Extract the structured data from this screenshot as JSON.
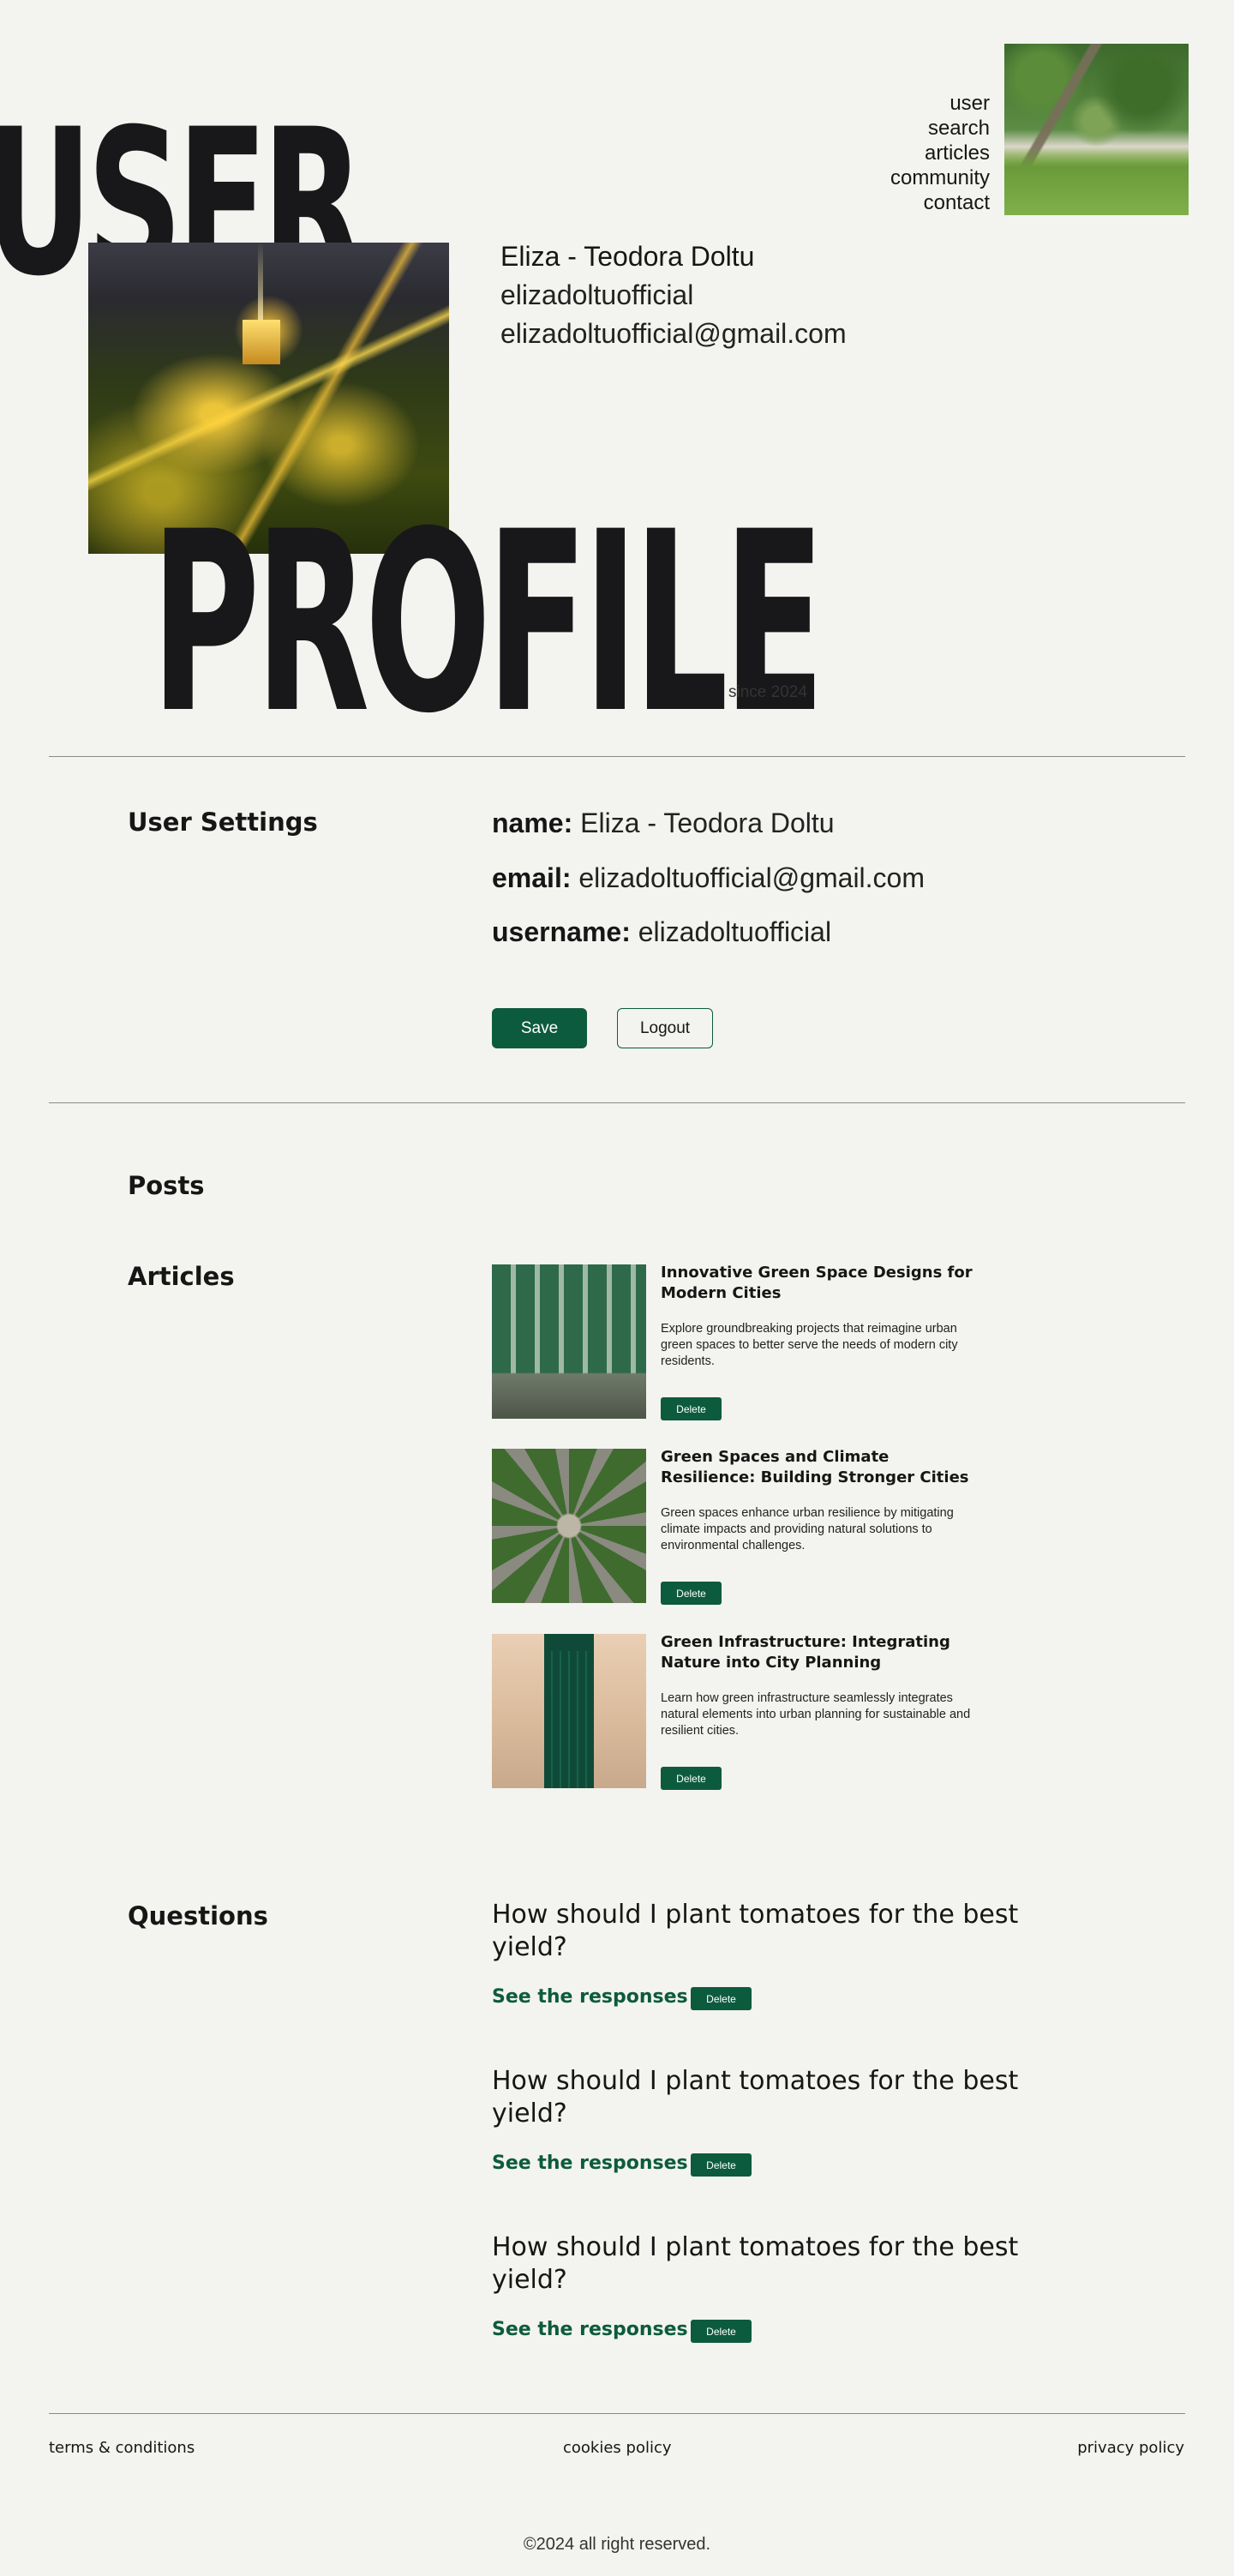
{
  "hero": {
    "word1": "USER",
    "word2": "PROFILE",
    "since": "since 2024"
  },
  "nav": {
    "items": [
      "user",
      "search",
      "articles",
      "community",
      "contact"
    ]
  },
  "profile": {
    "name": "Eliza - Teodora Doltu",
    "username": "elizadoltuofficial",
    "email": "elizadoltuofficial@gmail.com"
  },
  "settings": {
    "title": "User Settings",
    "name_label": "name:",
    "name_value": "Eliza - Teodora Doltu",
    "email_label": "email:",
    "email_value": "elizadoltuofficial@gmail.com",
    "username_label": "username:",
    "username_value": "elizadoltuofficial",
    "save_label": "Save",
    "logout_label": "Logout"
  },
  "posts": {
    "title": "Posts",
    "articles_title": "Articles",
    "articles": [
      {
        "title": "Innovative Green Space Designs for Modern Cities",
        "description": "Explore groundbreaking projects that reimagine urban green spaces to better serve the needs of modern city residents.",
        "delete_label": "Delete",
        "image": "train-greenery"
      },
      {
        "title": "Green Spaces and Climate Resilience: Building Stronger Cities",
        "description": "Green spaces enhance urban resilience by mitigating climate impacts and providing natural solutions to environmental challenges.",
        "delete_label": "Delete",
        "image": "aerial-garden"
      },
      {
        "title": "Green Infrastructure: Integrating Nature into City Planning",
        "description": "Learn how green infrastructure seamlessly integrates natural elements into urban planning for sustainable and resilient cities.",
        "delete_label": "Delete",
        "image": "green-door"
      }
    ],
    "questions_title": "Questions",
    "questions": [
      {
        "title": "How should I plant tomatoes for the best yield?",
        "link": "See the responses",
        "delete_label": "Delete"
      },
      {
        "title": "How should I plant tomatoes for the best yield?",
        "link": "See the responses",
        "delete_label": "Delete"
      },
      {
        "title": "How should I plant tomatoes for the best yield?",
        "link": "See the responses",
        "delete_label": "Delete"
      }
    ]
  },
  "footer": {
    "terms": "terms & conditions",
    "cookies": "cookies policy",
    "privacy": "privacy policy",
    "copyright": "©2024  all right reserved."
  },
  "colors": {
    "background": "#f3f3ef",
    "accent": "#0d5b3f",
    "text": "#161616"
  }
}
